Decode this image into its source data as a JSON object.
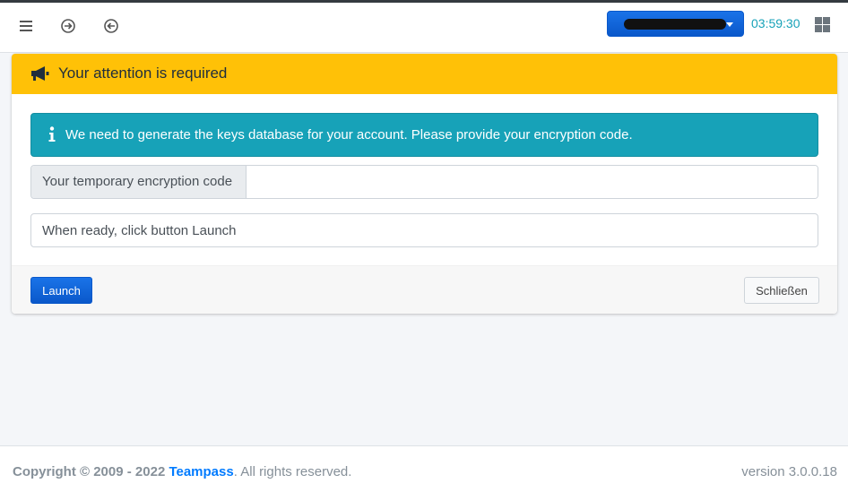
{
  "navbar": {
    "menu_icon": "hamburger-icon",
    "login_icon": "arrow-right-circle-icon",
    "logout_icon": "arrow-left-circle-icon",
    "user_menu_label": "",
    "session_timer": "03:59:30",
    "apps_icon": "grid-icon"
  },
  "card": {
    "header_icon": "megaphone-icon",
    "header_title": "Your attention is required",
    "alert_icon": "info-icon",
    "alert_message": "We need to generate the keys database for your account. Please provide your encryption code.",
    "encryption_label": "Your temporary encryption code",
    "encryption_value": "",
    "status_text": "When ready, click button Launch",
    "launch_label": "Launch",
    "close_label": "Schließen"
  },
  "footer": {
    "copyright": "Copyright © 2009 - 2022",
    "brand": "Teampass",
    "rights": ". All rights reserved.",
    "version": "version 3.0.0.18"
  },
  "colors": {
    "header_bg": "#ffc107",
    "alert_bg": "#17a2b8",
    "primary": "#0d6efd",
    "timer": "#17a2b8"
  }
}
